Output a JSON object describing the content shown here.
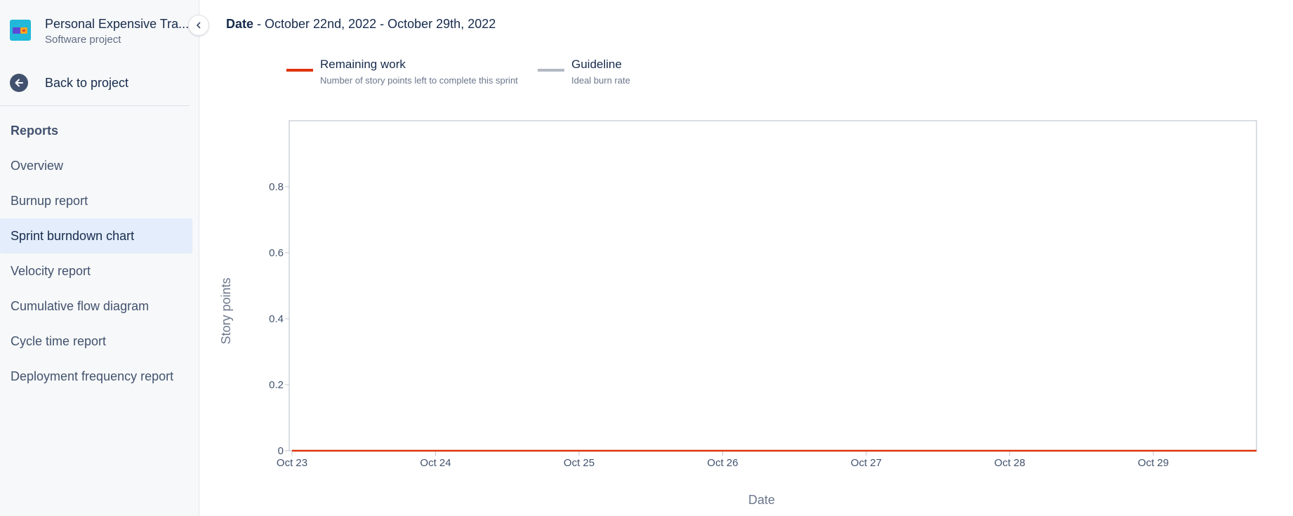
{
  "sidebar": {
    "project": {
      "name": "Personal Expensive Tra...",
      "type": "Software project",
      "avatar_icon": "project-cards-icon"
    },
    "collapse_icon": "chevron-left-icon",
    "back": {
      "label": "Back to project",
      "icon": "arrow-left-circle-icon"
    },
    "section_title": "Reports",
    "items": [
      {
        "label": "Overview",
        "active": false
      },
      {
        "label": "Burnup report",
        "active": false
      },
      {
        "label": "Sprint burndown chart",
        "active": true
      },
      {
        "label": "Velocity report",
        "active": false
      },
      {
        "label": "Cumulative flow diagram",
        "active": false
      },
      {
        "label": "Cycle time report",
        "active": false
      },
      {
        "label": "Deployment frequency report",
        "active": false
      }
    ]
  },
  "main": {
    "date_label": "Date",
    "date_range": " - October 22nd, 2022 - October 29th, 2022"
  },
  "legend": [
    {
      "title": "Remaining work",
      "description": "Number of story points left to complete this sprint",
      "color": "#de350b"
    },
    {
      "title": "Guideline",
      "description": "Ideal burn rate",
      "color": "#b3b9c4"
    }
  ],
  "chart_data": {
    "type": "line",
    "x": [
      "Oct 23",
      "Oct 24",
      "Oct 25",
      "Oct 26",
      "Oct 27",
      "Oct 28",
      "Oct 29"
    ],
    "xlabel": "Date",
    "ylabel": "Story points",
    "ylim": [
      0,
      1
    ],
    "yticks": [
      0,
      0.2,
      0.4,
      0.6,
      0.8
    ],
    "yticks_labels": [
      "0",
      "0.2",
      "0.4",
      "0.6",
      "0.8"
    ],
    "series": [
      {
        "name": "Remaining work",
        "color": "#de350b",
        "values": [
          0,
          0,
          0,
          0,
          0,
          0,
          0
        ]
      }
    ],
    "grid": false
  },
  "colors": {
    "accent": "#de350b",
    "guideline": "#b3b9c4",
    "active_nav_bg": "#e3edfb",
    "text_primary": "#172b4d"
  }
}
